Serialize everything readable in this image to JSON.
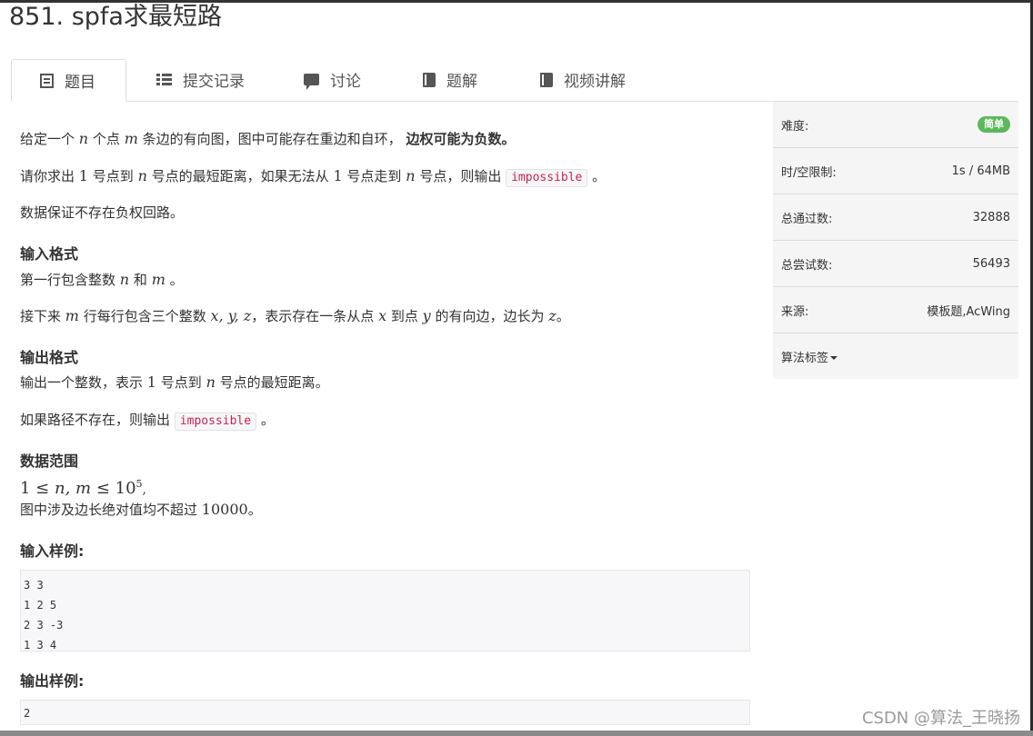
{
  "title": "851. spfa求最短路",
  "tabs": [
    {
      "label": "题目",
      "icon": "document-icon"
    },
    {
      "label": "提交记录",
      "icon": "list-icon"
    },
    {
      "label": "讨论",
      "icon": "chat-icon"
    },
    {
      "label": "题解",
      "icon": "book-icon"
    },
    {
      "label": "视频讲解",
      "icon": "book-icon"
    }
  ],
  "problem": {
    "p1": {
      "a": "给定一个",
      "n": "n",
      "b": "个点",
      "m": "m",
      "c": "条边的有向图，图中可能存在重边和自环，",
      "bold": "边权可能为负数。"
    },
    "p2": {
      "a": "请你求出",
      "one": "1",
      "b": "号点到",
      "n": "n",
      "c": "号点的最短距离，如果无法从",
      "one2": "1",
      "d": "号点走到",
      "n2": "n",
      "e": "号点，则输出",
      "code": "impossible",
      "f": "。"
    },
    "p3": "数据保证不存在负权回路。",
    "input_heading": "输入格式",
    "p4": {
      "a": "第一行包含整数",
      "n": "n",
      "b": "和",
      "m": "m",
      "c": "。"
    },
    "p5": {
      "a": "接下来",
      "m": "m",
      "b": "行每行包含三个整数",
      "xyz": "x, y, z",
      "c": "，表示存在一条从点",
      "x": "x",
      "d": "到点",
      "y": "y",
      "e": "的有向边，边长为",
      "z": "z",
      "f": "。"
    },
    "output_heading": "输出格式",
    "p6": {
      "a": "输出一个整数，表示",
      "one": "1",
      "b": "号点到",
      "n": "n",
      "c": "号点的最短距离。"
    },
    "p7": {
      "a": "如果路径不存在，则输出",
      "code": "impossible",
      "b": "。"
    },
    "range_heading": "数据范围",
    "range_formula": {
      "one": "1 ≤ ",
      "nm": "n, m",
      "le": " ≤ 10",
      "exp": "5",
      "comma": ","
    },
    "p8": {
      "a": "图中涉及边长绝对值均不超过",
      "num": "10000",
      "b": "。"
    },
    "sample_input_heading": "输入样例:",
    "sample_input": [
      "3 3",
      "1 2 5",
      "2 3 -3",
      "1 3 4"
    ],
    "sample_output_heading": "输出样例:",
    "sample_output": [
      "2"
    ]
  },
  "side": {
    "difficulty_label": "难度:",
    "difficulty_value": "简单",
    "limit_label": "时/空限制:",
    "limit_value": "1s / 64MB",
    "passed_label": "总通过数:",
    "passed_value": "32888",
    "tried_label": "总尝试数:",
    "tried_value": "56493",
    "source_label": "来源:",
    "source_value": "模板题,AcWing",
    "tags_label": "算法标签"
  },
  "watermark": "CSDN @算法_王晓扬",
  "colors": {
    "badge": "#5cb85c",
    "code": "#c7254e",
    "panel": "#f5f5f5"
  }
}
